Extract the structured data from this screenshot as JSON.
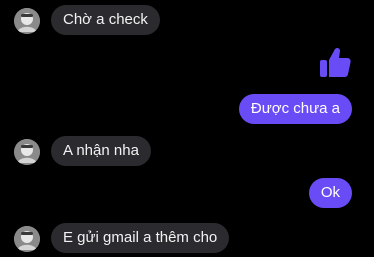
{
  "conversation": {
    "messages": [
      {
        "side": "incoming",
        "text": "Chờ a check"
      },
      {
        "side": "outgoing",
        "type": "like",
        "icon": "thumbs-up-icon"
      },
      {
        "side": "outgoing",
        "text": "Được chưa a"
      },
      {
        "side": "incoming",
        "text": "A nhận nha"
      },
      {
        "side": "outgoing",
        "text": "Ok"
      },
      {
        "side": "incoming",
        "text": "E gửi gmail a thêm cho"
      }
    ]
  },
  "colors": {
    "background": "#000000",
    "incoming_bubble": "#2b2b2f",
    "outgoing_bubble": "#6a4cf6",
    "like_icon": "#6a4cf6"
  }
}
